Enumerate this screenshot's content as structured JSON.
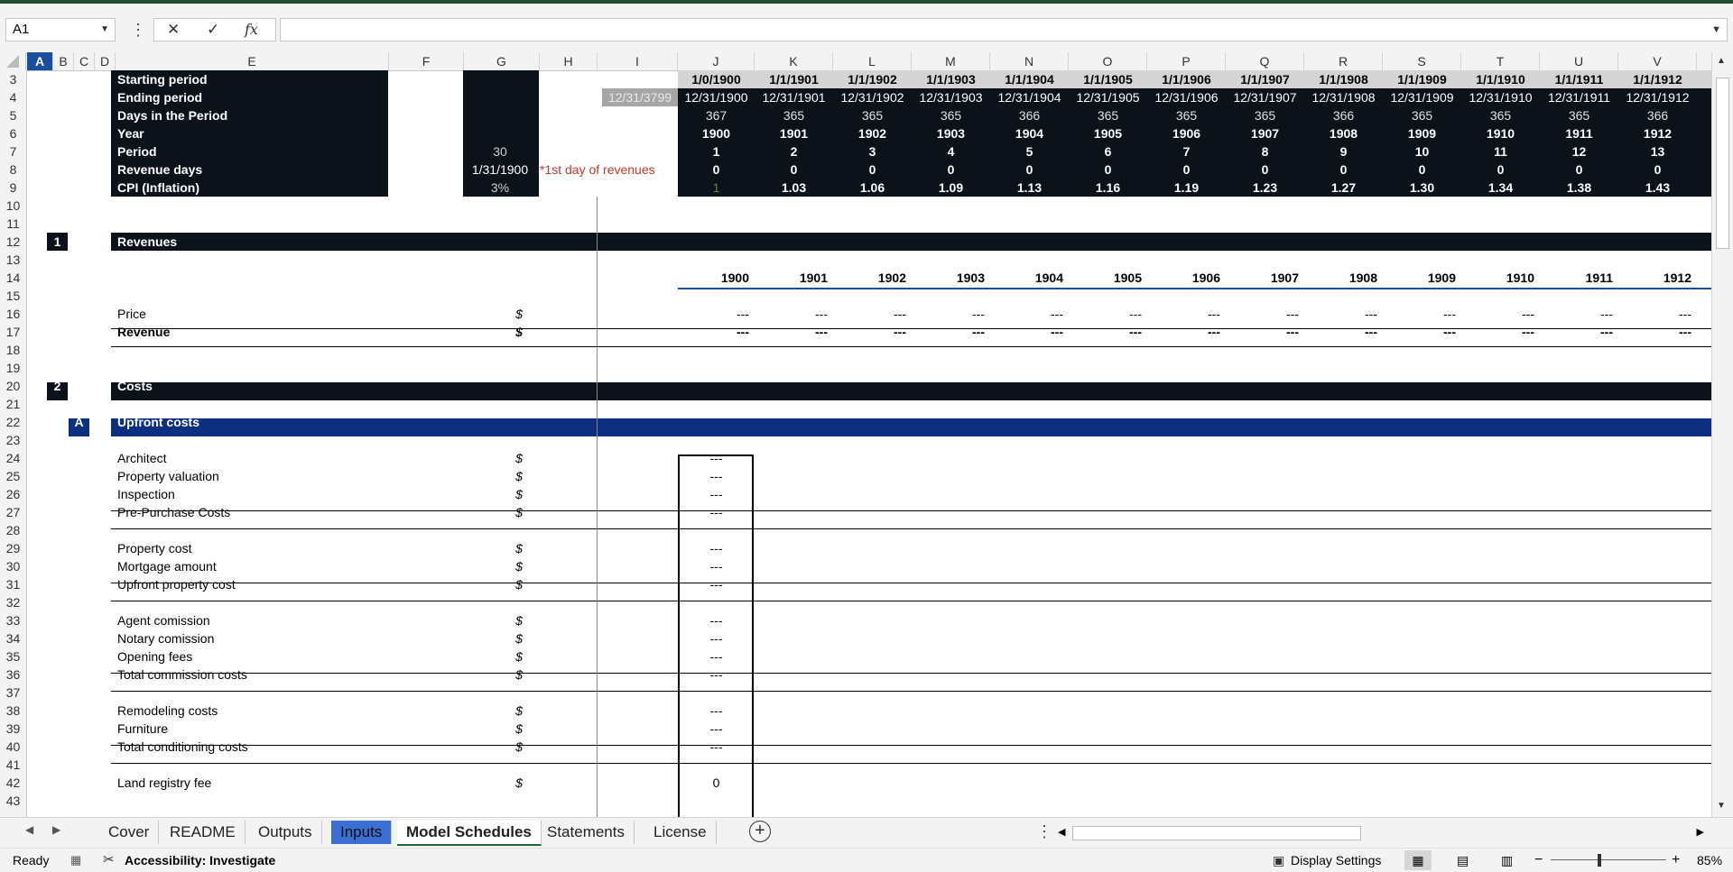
{
  "formula_bar": {
    "name_box": "A1",
    "cancel_icon": "x-icon",
    "enter_icon": "check-icon",
    "fx_label": "fx",
    "formula": ""
  },
  "columns": [
    "A",
    "B",
    "C",
    "D",
    "E",
    "F",
    "G",
    "H",
    "I",
    "J",
    "K",
    "L",
    "M",
    "N",
    "O",
    "P",
    "Q",
    "R",
    "S",
    "T",
    "U",
    "V"
  ],
  "rows": [
    "3",
    "4",
    "5",
    "6",
    "7",
    "8",
    "9",
    "10",
    "11",
    "12",
    "13",
    "14",
    "15",
    "16",
    "17",
    "18",
    "19",
    "20",
    "21",
    "22",
    "23",
    "24",
    "25",
    "26",
    "27",
    "28",
    "29",
    "30",
    "31",
    "32",
    "33",
    "34",
    "35",
    "36",
    "37",
    "38",
    "39",
    "40",
    "41",
    "42",
    "43"
  ],
  "timing": {
    "labels": [
      "Starting period",
      "Ending period",
      "Days in the Period",
      "Year",
      "Period",
      "Revenue days",
      "CPI (Inflation)"
    ],
    "g_values": [
      "",
      "",
      "",
      "",
      "30",
      "1/31/1900",
      "3%"
    ],
    "note": "*1st day of revenues",
    "i_value": "12/31/3799",
    "starting": [
      "1/0/1900",
      "1/1/1901",
      "1/1/1902",
      "1/1/1903",
      "1/1/1904",
      "1/1/1905",
      "1/1/1906",
      "1/1/1907",
      "1/1/1908",
      "1/1/1909",
      "1/1/1910",
      "1/1/1911",
      "1/1/1912"
    ],
    "ending": [
      "12/31/1900",
      "12/31/1901",
      "12/31/1902",
      "12/31/1903",
      "12/31/1904",
      "12/31/1905",
      "12/31/1906",
      "12/31/1907",
      "12/31/1908",
      "12/31/1909",
      "12/31/1910",
      "12/31/1911",
      "12/31/1912"
    ],
    "days": [
      "367",
      "365",
      "365",
      "365",
      "366",
      "365",
      "365",
      "365",
      "366",
      "365",
      "365",
      "365",
      "366"
    ],
    "year": [
      "1900",
      "1901",
      "1902",
      "1903",
      "1904",
      "1905",
      "1906",
      "1907",
      "1908",
      "1909",
      "1910",
      "1911",
      "1912"
    ],
    "period": [
      "1",
      "2",
      "3",
      "4",
      "5",
      "6",
      "7",
      "8",
      "9",
      "10",
      "11",
      "12",
      "13"
    ],
    "revenue_days": [
      "0",
      "0",
      "0",
      "0",
      "0",
      "0",
      "0",
      "0",
      "0",
      "0",
      "0",
      "0",
      "0"
    ],
    "cpi": [
      "1",
      "1.03",
      "1.06",
      "1.09",
      "1.13",
      "1.16",
      "1.19",
      "1.23",
      "1.27",
      "1.30",
      "1.34",
      "1.38",
      "1.43"
    ]
  },
  "revenues": {
    "num": "1",
    "title": "Revenues",
    "years": [
      "1900",
      "1901",
      "1902",
      "1903",
      "1904",
      "1905",
      "1906",
      "1907",
      "1908",
      "1909",
      "1910",
      "1911",
      "1912"
    ],
    "price_label": "Price",
    "revenue_label": "Revenue",
    "unit": "$",
    "dash": "---"
  },
  "costs": {
    "num": "2",
    "title": "Costs",
    "sub_letter": "A",
    "sub_title": "Upfront costs",
    "unit": "$",
    "items": [
      {
        "label": "Architect",
        "value": "---"
      },
      {
        "label": "Property valuation",
        "value": "---"
      },
      {
        "label": "Inspection",
        "value": "---"
      },
      {
        "label": "Pre-Purchase Costs",
        "value": "---"
      },
      {
        "label": "Property cost",
        "value": "---"
      },
      {
        "label": "Mortgage amount",
        "value": "---"
      },
      {
        "label": "Upfront property cost",
        "value": "---"
      },
      {
        "label": "Agent comission",
        "value": "---"
      },
      {
        "label": "Notary comission",
        "value": "---"
      },
      {
        "label": "Opening fees",
        "value": "---"
      },
      {
        "label": "Total commission costs",
        "value": "---"
      },
      {
        "label": "Remodeling costs",
        "value": "---"
      },
      {
        "label": "Furniture",
        "value": "---"
      },
      {
        "label": "Total conditioning costs",
        "value": "---"
      },
      {
        "label": "Land registry fee",
        "value": "0"
      }
    ]
  },
  "tabs": [
    "Cover",
    "README",
    "Outputs",
    "Inputs",
    "Model Schedules",
    "Statements",
    "License"
  ],
  "status": {
    "ready": "Ready",
    "accessibility": "Accessibility: Investigate",
    "display_settings": "Display Settings",
    "zoom": "85%"
  }
}
